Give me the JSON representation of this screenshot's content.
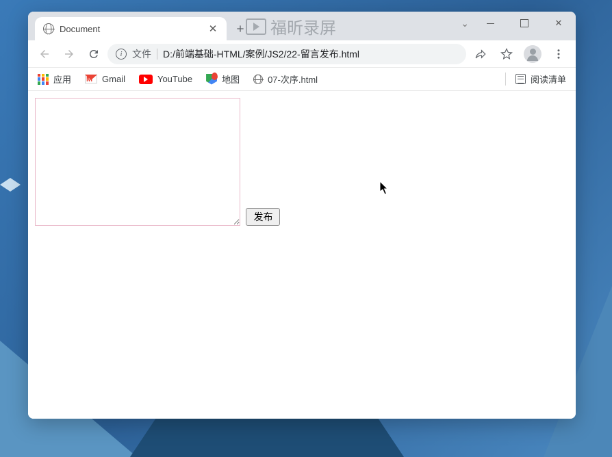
{
  "tab": {
    "title": "Document"
  },
  "recorder": {
    "label": "福昕录屏"
  },
  "omnibox": {
    "scheme_label": "文件",
    "url": "D:/前端基础-HTML/案例/JS2/22-留言发布.html"
  },
  "bookmarks": {
    "apps": "应用",
    "gmail": "Gmail",
    "youtube": "YouTube",
    "maps": "地图",
    "sequence": "07-次序.html",
    "reading_list": "阅读清单"
  },
  "page": {
    "textarea_value": "",
    "publish_label": "发布"
  }
}
